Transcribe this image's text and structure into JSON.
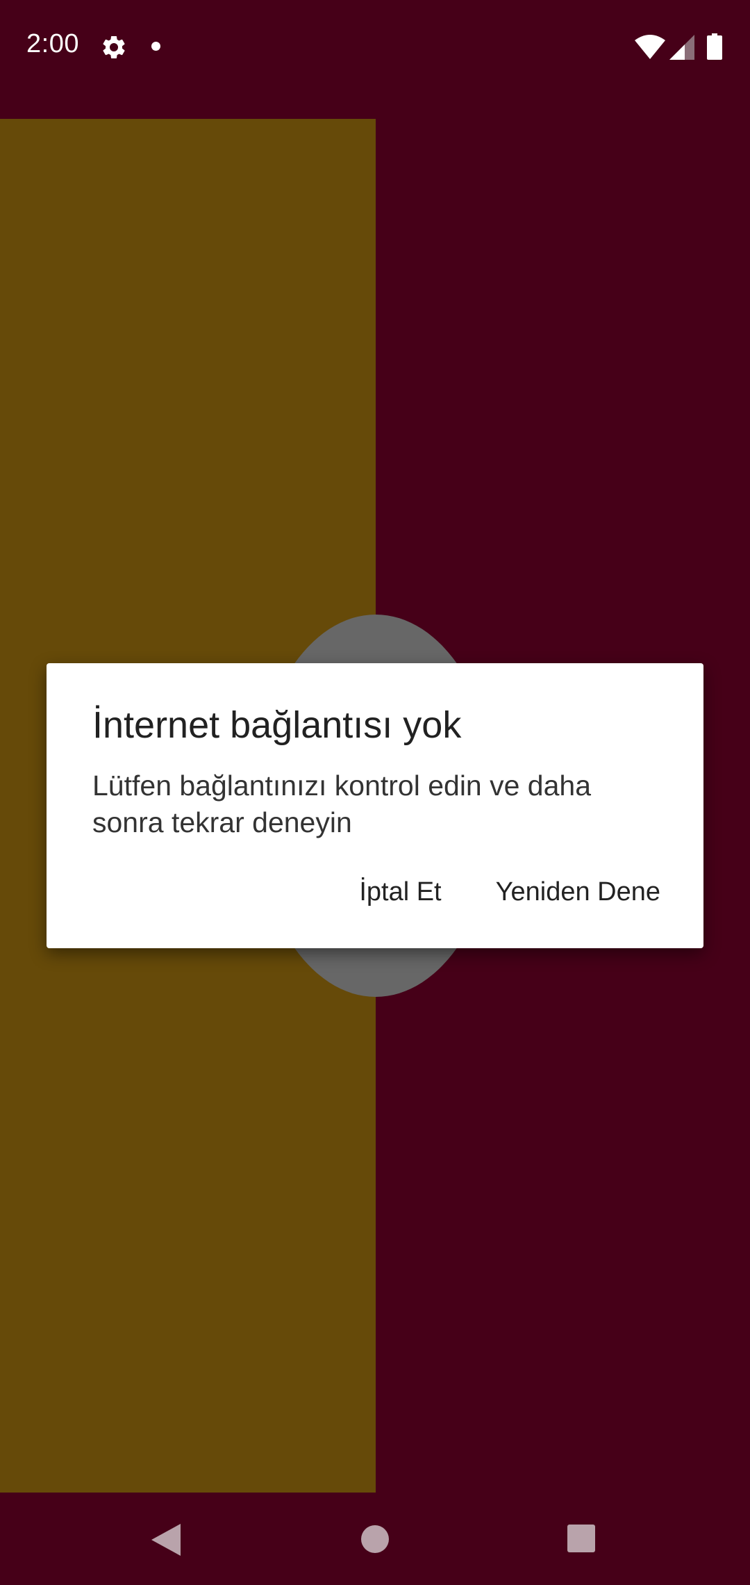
{
  "status_bar": {
    "time": "2:00",
    "icons": [
      "gear-icon",
      "notification-dot-icon",
      "wifi-icon",
      "signal-icon",
      "battery-icon"
    ]
  },
  "dialog": {
    "title": "İnternet bağlantısı yok",
    "message": "Lütfen bağlantınızı kontrol edin ve daha sonra tekrar deneyin",
    "cancel_label": "İptal Et",
    "retry_label": "Yeniden Dene"
  },
  "nav_bar": {
    "icons": [
      "back-icon",
      "home-icon",
      "recents-icon"
    ]
  },
  "colors": {
    "background": "#460018",
    "left_panel": "#664a09",
    "circle": "#676767",
    "dialog": "#ffffff"
  }
}
